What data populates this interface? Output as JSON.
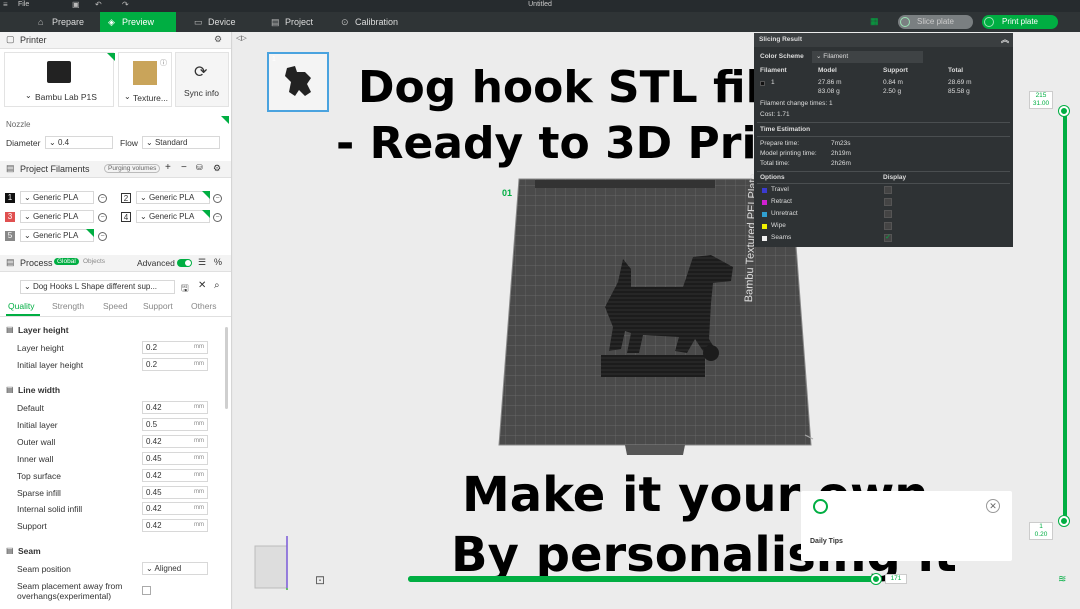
{
  "window": {
    "file_menu": "File",
    "title": "Untitled"
  },
  "tabs": [
    {
      "label": "Prepare",
      "icon": "home-icon"
    },
    {
      "label": "Preview",
      "icon": "cube-icon"
    },
    {
      "label": "Device",
      "icon": "device-icon"
    },
    {
      "label": "Project",
      "icon": "project-icon"
    },
    {
      "label": "Calibration",
      "icon": "calibration-icon"
    }
  ],
  "toolbar": {
    "slice_label": "Slice plate",
    "print_label": "Print plate"
  },
  "printer": {
    "section_title": "Printer",
    "printer_name": "Bambu Lab P1S",
    "plate_name": "Texture...",
    "sync_label": "Sync info",
    "nozzle_label": "Nozzle",
    "diameter_label": "Diameter",
    "diameter_value": "0.4",
    "flow_label": "Flow",
    "flow_value": "Standard"
  },
  "filaments": {
    "section_title": "Project Filaments",
    "purging_label": "Purging volumes",
    "items": [
      {
        "num": "1",
        "name": "Generic PLA",
        "color": "#111111"
      },
      {
        "num": "2",
        "name": "Generic PLA",
        "color": "#ffffff"
      },
      {
        "num": "3",
        "name": "Generic PLA",
        "color": "#e05050"
      },
      {
        "num": "4",
        "name": "Generic PLA",
        "color": "#ffffff"
      },
      {
        "num": "5",
        "name": "Generic PLA",
        "color": "#888888"
      }
    ]
  },
  "process": {
    "section_title": "Process",
    "global_label": "Global",
    "objects_label": "Objects",
    "advanced_label": "Advanced",
    "preset_name": "Dog Hooks L Shape different sup...",
    "tabs": [
      "Quality",
      "Strength",
      "Speed",
      "Support",
      "Others"
    ],
    "layer_height_title": "Layer height",
    "layer_height_label": "Layer height",
    "layer_height_value": "0.2",
    "initial_layer_height_label": "Initial layer height",
    "initial_layer_height_value": "0.2",
    "unit_mm": "mm",
    "line_width_title": "Line width",
    "line_widths": [
      {
        "label": "Default",
        "value": "0.42"
      },
      {
        "label": "Initial layer",
        "value": "0.5"
      },
      {
        "label": "Outer wall",
        "value": "0.42"
      },
      {
        "label": "Inner wall",
        "value": "0.45"
      },
      {
        "label": "Top surface",
        "value": "0.42"
      },
      {
        "label": "Sparse infill",
        "value": "0.45"
      },
      {
        "label": "Internal solid infill",
        "value": "0.42"
      },
      {
        "label": "Support",
        "value": "0.42"
      }
    ],
    "seam_title": "Seam",
    "seam_position_label": "Seam position",
    "seam_position_value": "Aligned",
    "seam_away_label": "Seam placement away from overhangs(experimental)"
  },
  "plate": {
    "thumb_number": "1",
    "bed_label": "Bambu Textured PEI Plate",
    "plate_number": "01"
  },
  "overlay_text": {
    "line1": "Dog hook STL file",
    "line2": "- Ready to 3D Print",
    "line3": "Make it your own",
    "line4": "By personalising it"
  },
  "slicing_result": {
    "title": "Slicing Result",
    "color_scheme_label": "Color Scheme",
    "color_scheme_value": "Filament",
    "headers": [
      "Filament",
      "Model",
      "Support",
      "Total"
    ],
    "row": {
      "filament": "1",
      "model_m": "27.86 m",
      "model_g": "83.08 g",
      "support_m": "0.84 m",
      "support_g": "2.50 g",
      "total_m": "28.69 m",
      "total_g": "85.58 g"
    },
    "filament_change": "Filament change times:  1",
    "cost": "Cost:  1.71",
    "time_title": "Time Estimation",
    "prepare_time_label": "Prepare time:",
    "prepare_time_value": "7m23s",
    "model_time_label": "Model printing time:",
    "model_time_value": "2h19m",
    "total_time_label": "Total time:",
    "total_time_value": "2h26m",
    "options_label": "Options",
    "display_label": "Display",
    "options": [
      {
        "name": "Travel",
        "color": "#3b3bd0",
        "checked": false
      },
      {
        "name": "Retract",
        "color": "#d020d0",
        "checked": false
      },
      {
        "name": "Unretract",
        "color": "#30a0d0",
        "checked": false
      },
      {
        "name": "Wipe",
        "color": "#f0f000",
        "checked": false
      },
      {
        "name": "Seams",
        "color": "#f0f0f0",
        "checked": true
      }
    ]
  },
  "layer_slider": {
    "top_value": "215",
    "top_height": "31.00",
    "bottom_value": "1",
    "bottom_height": "0.20",
    "move_value": "171",
    "move_progress": 1.0
  },
  "tips": {
    "title": "Daily Tips"
  },
  "colors": {
    "accent": "#00ae42"
  }
}
